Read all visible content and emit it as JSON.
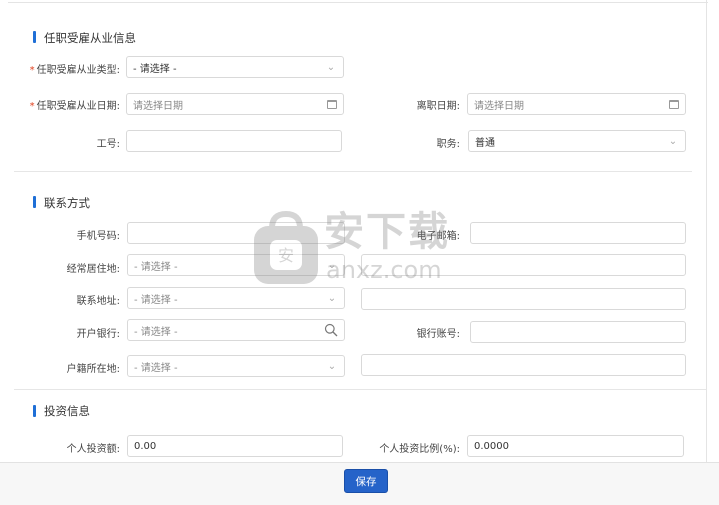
{
  "sections": {
    "employment": {
      "title": "任职受雇从业信息"
    },
    "contact": {
      "title": "联系方式"
    },
    "investment": {
      "title": "投资信息"
    }
  },
  "employment": {
    "type_label": "任职受雇从业类型:",
    "type_value": "- 请选择 -",
    "date_label": "任职受雇从业日期:",
    "date_placeholder": "请选择日期",
    "leave_label": "离职日期:",
    "leave_placeholder": "请选择日期",
    "jobno_label": "工号:",
    "jobno_value": "",
    "position_label": "职务:",
    "position_value": "普通"
  },
  "contact": {
    "phone_label": "手机号码:",
    "email_label": "电子邮箱:",
    "residence_label": "经常居住地:",
    "residence_value": "- 请选择 -",
    "address_label": "联系地址:",
    "address_value": "- 请选择 -",
    "bank_label": "开户银行:",
    "bank_value": "- 请选择 -",
    "account_label": "银行账号:",
    "hukou_label": "户籍所在地:",
    "hukou_value": "- 请选择 -"
  },
  "investment": {
    "amount_label": "个人投资额:",
    "amount_value": "0.00",
    "ratio_label": "个人投资比例(%):",
    "ratio_value": "0.0000"
  },
  "footer": {
    "save_label": "保存"
  },
  "watermark": {
    "cn": "安下载",
    "en": "anxz.com"
  }
}
